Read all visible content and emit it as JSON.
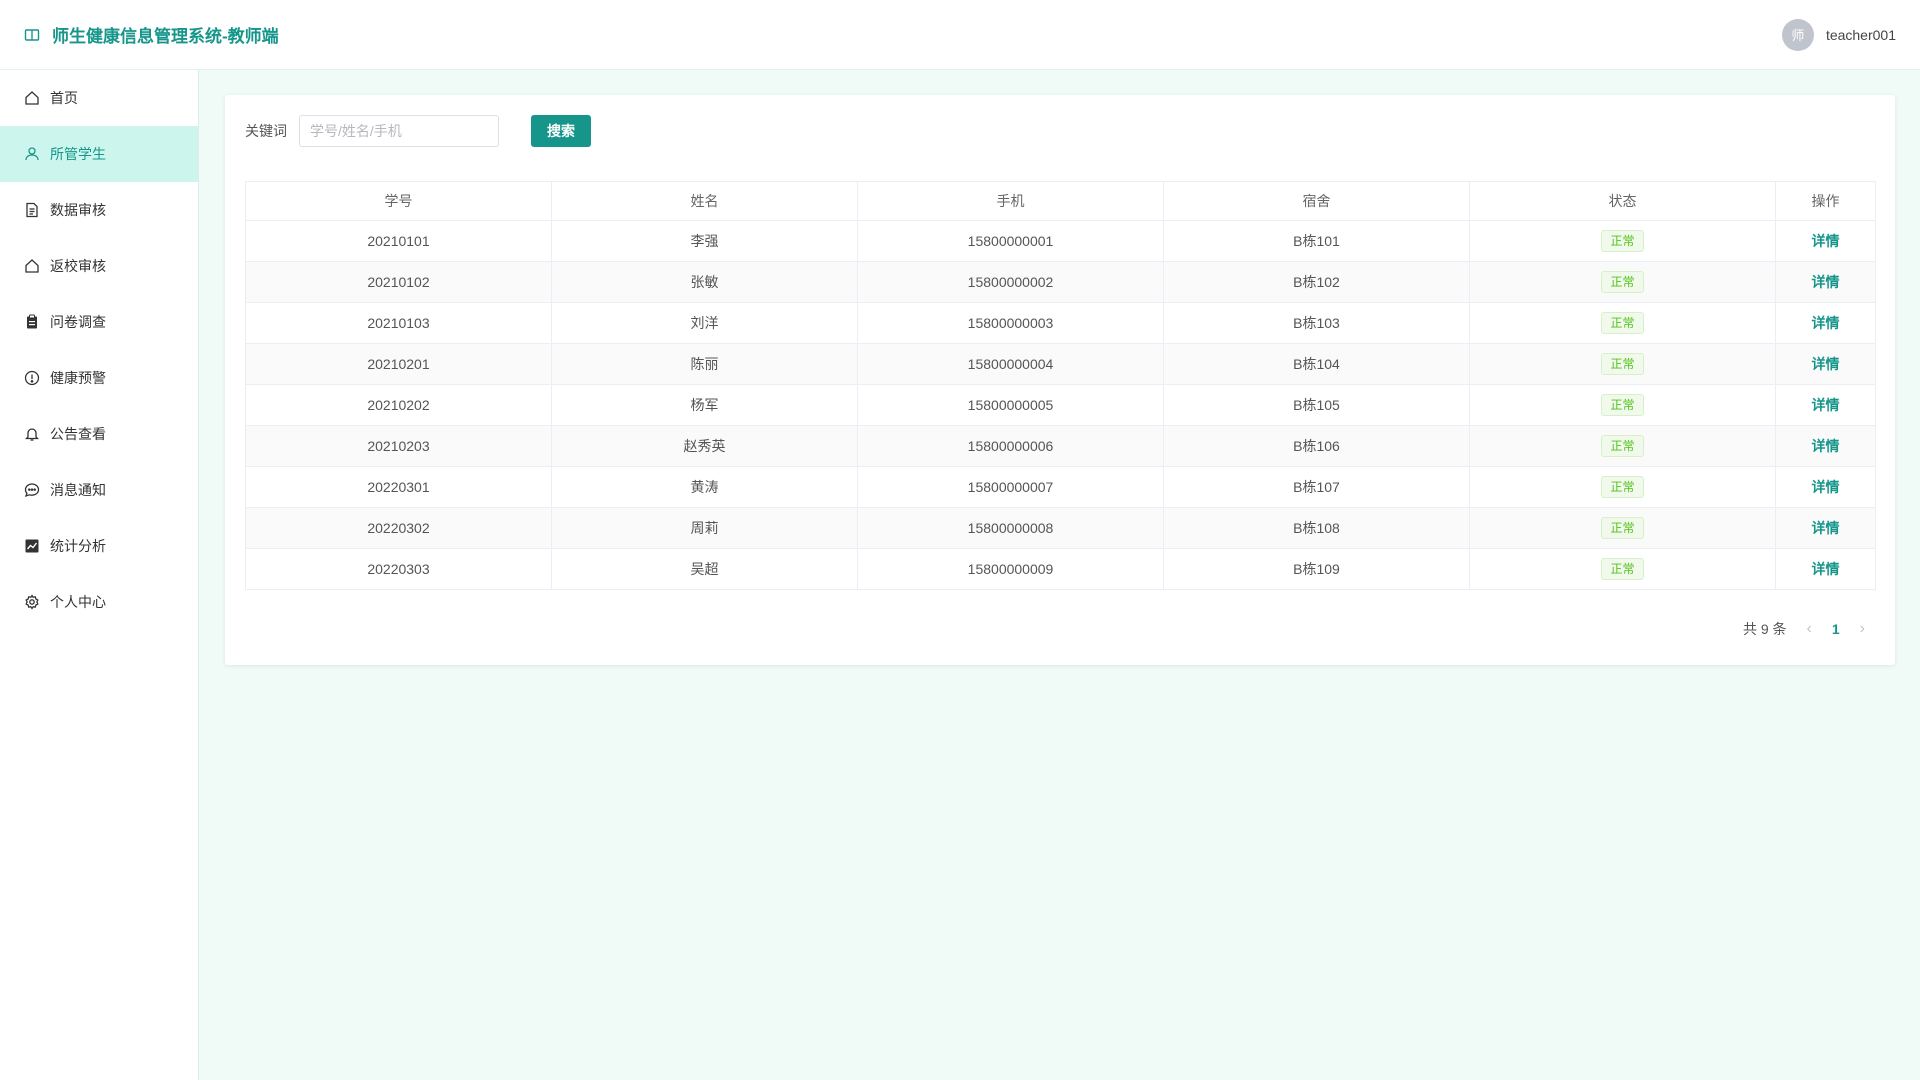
{
  "header": {
    "title": "师生健康信息管理系统-教师端",
    "avatar_text": "师",
    "username": "teacher001"
  },
  "sidebar": {
    "items": [
      {
        "label": "首页",
        "icon": "home-icon"
      },
      {
        "label": "所管学生",
        "icon": "user-icon"
      },
      {
        "label": "数据审核",
        "icon": "document-icon"
      },
      {
        "label": "返校审核",
        "icon": "house-icon"
      },
      {
        "label": "问卷调查",
        "icon": "clipboard-icon"
      },
      {
        "label": "健康预警",
        "icon": "warning-icon"
      },
      {
        "label": "公告查看",
        "icon": "bell-icon"
      },
      {
        "label": "消息通知",
        "icon": "chat-icon"
      },
      {
        "label": "统计分析",
        "icon": "chart-icon"
      },
      {
        "label": "个人中心",
        "icon": "gear-icon"
      }
    ],
    "active_index": 1
  },
  "search": {
    "label": "关键词",
    "placeholder": "学号/姓名/手机",
    "value": "",
    "button_label": "搜索"
  },
  "table": {
    "columns": [
      "学号",
      "姓名",
      "手机",
      "宿舍",
      "状态",
      "操作"
    ],
    "rows": [
      {
        "id": "20210101",
        "name": "李强",
        "phone": "15800000001",
        "dorm": "B栋101",
        "status": "正常",
        "action": "详情"
      },
      {
        "id": "20210102",
        "name": "张敏",
        "phone": "15800000002",
        "dorm": "B栋102",
        "status": "正常",
        "action": "详情"
      },
      {
        "id": "20210103",
        "name": "刘洋",
        "phone": "15800000003",
        "dorm": "B栋103",
        "status": "正常",
        "action": "详情"
      },
      {
        "id": "20210201",
        "name": "陈丽",
        "phone": "15800000004",
        "dorm": "B栋104",
        "status": "正常",
        "action": "详情"
      },
      {
        "id": "20210202",
        "name": "杨军",
        "phone": "15800000005",
        "dorm": "B栋105",
        "status": "正常",
        "action": "详情"
      },
      {
        "id": "20210203",
        "name": "赵秀英",
        "phone": "15800000006",
        "dorm": "B栋106",
        "status": "正常",
        "action": "详情"
      },
      {
        "id": "20220301",
        "name": "黄涛",
        "phone": "15800000007",
        "dorm": "B栋107",
        "status": "正常",
        "action": "详情"
      },
      {
        "id": "20220302",
        "name": "周莉",
        "phone": "15800000008",
        "dorm": "B栋108",
        "status": "正常",
        "action": "详情"
      },
      {
        "id": "20220303",
        "name": "吴超",
        "phone": "15800000009",
        "dorm": "B栋109",
        "status": "正常",
        "action": "详情"
      }
    ]
  },
  "pagination": {
    "total_text": "共 9 条",
    "current_page": "1",
    "prev_icon": "chevron-left-icon",
    "next_icon": "chevron-right-icon"
  },
  "colors": {
    "primary": "#16968a",
    "active_bg": "#ccf6ed",
    "page_bg": "#f0fbf8",
    "status_green": "#52c41a"
  }
}
